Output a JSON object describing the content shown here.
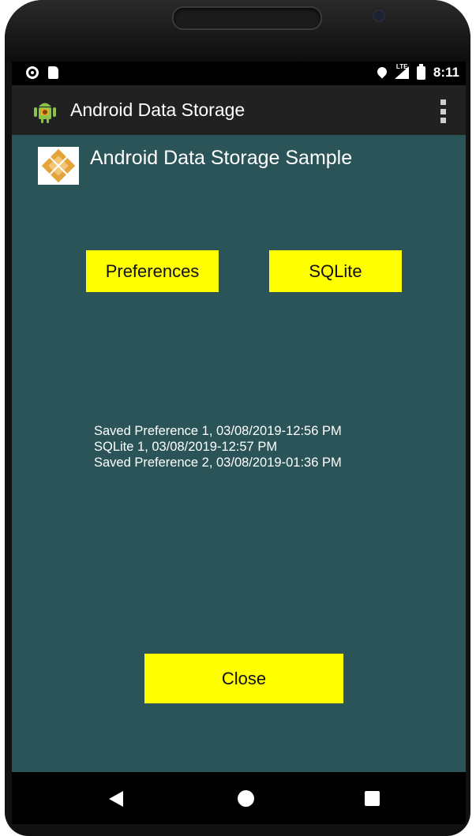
{
  "status_bar": {
    "time": "8:11",
    "icons": [
      "radio-button-icon",
      "sd-card-icon",
      "location-icon",
      "lte-signal-icon",
      "battery-charging-icon"
    ],
    "lte_label": "LTE"
  },
  "action_bar": {
    "title": "Android Data Storage",
    "icons": [
      "android-app-icon",
      "overflow-menu-icon"
    ]
  },
  "main": {
    "header_title": "Android Data Storage Sample",
    "buttons": {
      "preferences": "Preferences",
      "sqlite": "SQLite",
      "close": "Close"
    },
    "log_entries": [
      "Saved Preference 1, 03/08/2019-12:56 PM",
      "SQLite 1, 03/08/2019-12:57 PM",
      "Saved Preference 2, 03/08/2019-01:36 PM"
    ]
  },
  "nav_bar": {
    "icons": [
      "back-icon",
      "home-icon",
      "recents-icon"
    ]
  },
  "colors": {
    "screen_background": "#2a5457",
    "button_background": "#ffff00",
    "action_bar": "#212121",
    "status_bar": "#000000"
  }
}
